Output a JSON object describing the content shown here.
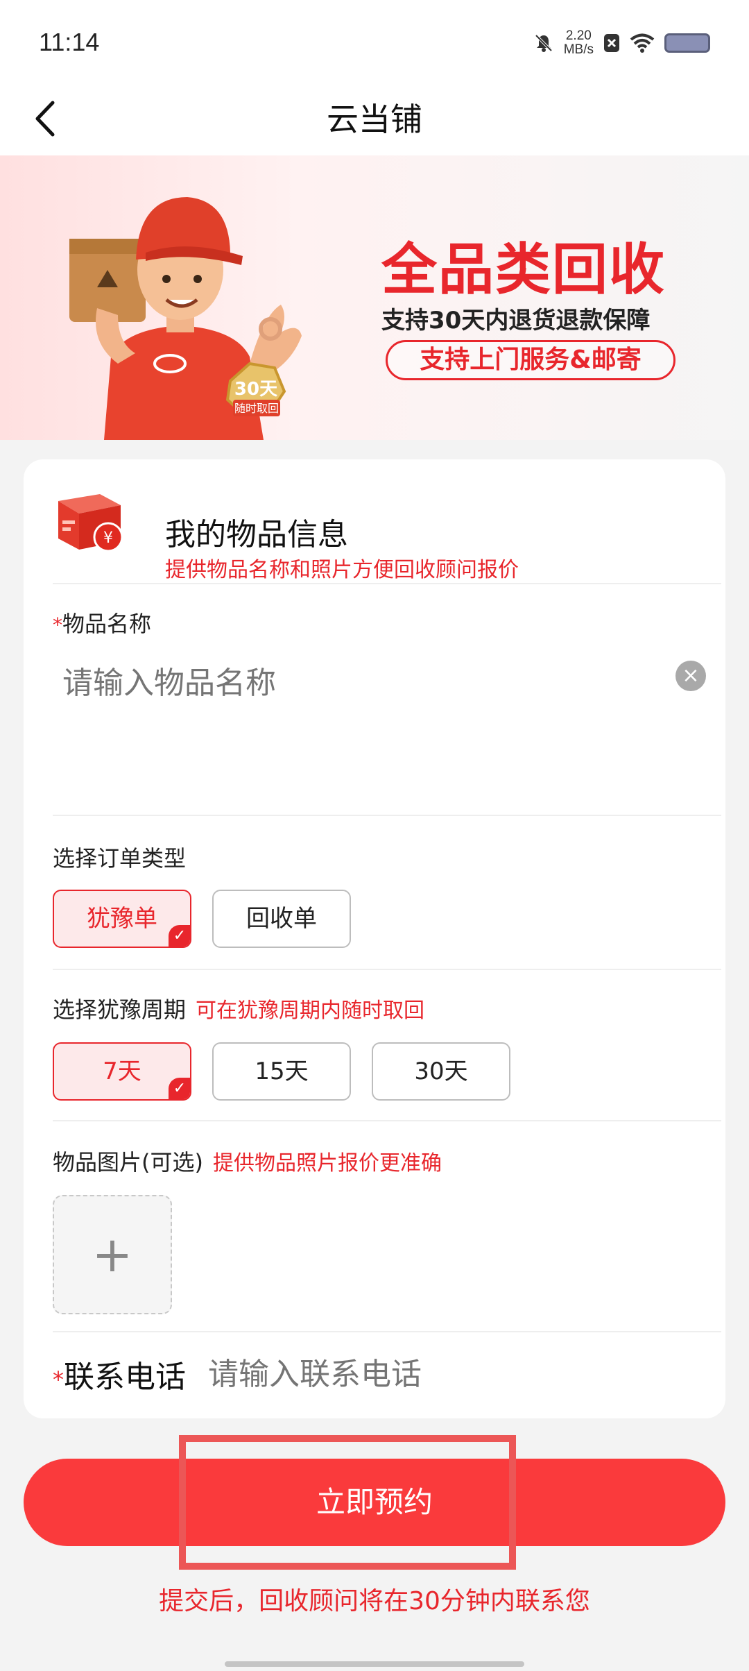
{
  "status_bar": {
    "time": "11:14",
    "net_speed_value": "2.20",
    "net_speed_unit": "MB/s"
  },
  "nav": {
    "title": "云当铺"
  },
  "banner": {
    "headline": "全品类回收",
    "subline": "支持30天内退货退款保障",
    "pill": "支持上门服务&邮寄",
    "medal_number": "30天",
    "medal_caption": "随时取回"
  },
  "item_info": {
    "title": "我的物品信息",
    "hint": "提供物品名称和照片方便回收顾问报价",
    "name_label": "物品名称",
    "name_placeholder": "请输入物品名称"
  },
  "order_type": {
    "label": "选择订单类型",
    "options": [
      "犹豫单",
      "回收单"
    ],
    "selected": "犹豫单"
  },
  "period": {
    "label": "选择犹豫周期",
    "hint": "可在犹豫周期内随时取回",
    "options": [
      "7天",
      "15天",
      "30天"
    ],
    "selected": "7天"
  },
  "photos": {
    "label": "物品图片(可选)",
    "hint": "提供物品照片报价更准确"
  },
  "phone": {
    "label": "联系电话",
    "placeholder": "请输入联系电话"
  },
  "submit": {
    "label": "立即预约",
    "note": "提交后，回收顾问将在30分钟内联系您"
  },
  "colors": {
    "accent": "#e8262c",
    "button": "#fa3a3c",
    "selected_bg": "#fde9ea"
  }
}
